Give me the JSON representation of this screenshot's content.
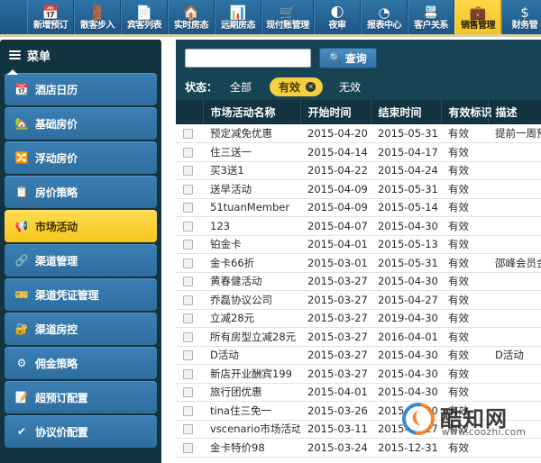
{
  "toolbar": {
    "items": [
      {
        "label": "新增预订",
        "icon": "calendar-icon",
        "active": false
      },
      {
        "label": "散客步入",
        "icon": "door-icon",
        "active": false
      },
      {
        "label": "宾客列表",
        "icon": "document-icon",
        "active": false
      },
      {
        "label": "实时房态",
        "icon": "home-icon",
        "active": false
      },
      {
        "label": "远期房态",
        "icon": "bar-chart-icon",
        "active": false
      },
      {
        "label": "现付账管理",
        "icon": "cart-icon",
        "active": false
      },
      {
        "label": "夜审",
        "icon": "moon-report-icon",
        "active": false
      },
      {
        "label": "报表中心",
        "icon": "pie-chart-icon",
        "active": false
      },
      {
        "label": "客户关系",
        "icon": "contact-card-icon",
        "active": false
      },
      {
        "label": "销售管理",
        "icon": "briefcase-icon",
        "active": true
      },
      {
        "label": "财务管",
        "icon": "dollar-icon",
        "active": false
      }
    ]
  },
  "sidebar": {
    "header": "菜单",
    "header_icon": "hamburger-icon",
    "items": [
      {
        "label": "酒店日历",
        "icon": "calendar-gear-icon",
        "active": false
      },
      {
        "label": "基础房价",
        "icon": "house-gear-icon",
        "active": false
      },
      {
        "label": "浮动房价",
        "icon": "arrow-gear-icon",
        "active": false
      },
      {
        "label": "房价策略",
        "icon": "list-gear-icon",
        "active": false
      },
      {
        "label": "市场活动",
        "icon": "megaphone-gear-icon",
        "active": true
      },
      {
        "label": "渠道管理",
        "icon": "channel-gear-icon",
        "active": false
      },
      {
        "label": "渠道凭证管理",
        "icon": "voucher-gear-icon",
        "active": false
      },
      {
        "label": "渠道房控",
        "icon": "control-gear-icon",
        "active": false
      },
      {
        "label": "佣金策略",
        "icon": "commission-gear-icon",
        "active": false
      },
      {
        "label": "超预订配置",
        "icon": "overbooking-gear-icon",
        "active": false
      },
      {
        "label": "协议价配置",
        "icon": "agreement-ok-icon",
        "active": false
      }
    ]
  },
  "filter": {
    "search_value": "",
    "search_placeholder": "",
    "search_button": "查询",
    "search_icon": "search-icon",
    "status_label": "状态：",
    "status_options": [
      {
        "label": "全部",
        "selected": false
      },
      {
        "label": "有效",
        "selected": true
      },
      {
        "label": "无效",
        "selected": false
      }
    ],
    "clear_icon": "close-circle-icon"
  },
  "table": {
    "columns": [
      "市场活动名称",
      "开始时间",
      "结束时间",
      "有效标识",
      "描述"
    ],
    "rows": [
      {
        "name": "预定减免优惠",
        "start": "2015-04-20",
        "end": "2015-05-31",
        "flag": "有效",
        "desc": "提前一周预订"
      },
      {
        "name": "住三送一",
        "start": "2015-04-14",
        "end": "2015-04-17",
        "flag": "有效",
        "desc": ""
      },
      {
        "name": "买3送1",
        "start": "2015-04-22",
        "end": "2015-04-24",
        "flag": "有效",
        "desc": ""
      },
      {
        "name": "送早活动",
        "start": "2015-04-09",
        "end": "2015-05-31",
        "flag": "有效",
        "desc": ""
      },
      {
        "name": "51tuanMember",
        "start": "2015-04-09",
        "end": "2015-05-14",
        "flag": "有效",
        "desc": ""
      },
      {
        "name": "123",
        "start": "2015-04-07",
        "end": "2015-04-30",
        "flag": "有效",
        "desc": ""
      },
      {
        "name": "铂金卡",
        "start": "2015-04-01",
        "end": "2015-05-13",
        "flag": "有效",
        "desc": ""
      },
      {
        "name": "金卡66折",
        "start": "2015-03-01",
        "end": "2015-05-31",
        "flag": "有效",
        "desc": "邵峰会员金卡"
      },
      {
        "name": "黄春健活动",
        "start": "2015-03-27",
        "end": "2015-04-30",
        "flag": "有效",
        "desc": ""
      },
      {
        "name": "乔磊协议公司",
        "start": "2015-03-27",
        "end": "2015-04-27",
        "flag": "有效",
        "desc": ""
      },
      {
        "name": "立减28元",
        "start": "2015-03-27",
        "end": "2019-04-30",
        "flag": "有效",
        "desc": ""
      },
      {
        "name": "所有房型立减28元",
        "start": "2015-03-27",
        "end": "2016-04-01",
        "flag": "有效",
        "desc": ""
      },
      {
        "name": "D活动",
        "start": "2015-03-27",
        "end": "2015-04-30",
        "flag": "有效",
        "desc": "D活动"
      },
      {
        "name": "新店开业酬宾199",
        "start": "2015-03-27",
        "end": "2015-04-30",
        "flag": "有效",
        "desc": ""
      },
      {
        "name": "旅行团优惠",
        "start": "2015-04-01",
        "end": "2015-04-30",
        "flag": "有效",
        "desc": ""
      },
      {
        "name": "tina住三免一",
        "start": "2015-03-26",
        "end": "2015-04-30",
        "flag": "有效",
        "desc": ""
      },
      {
        "name": "vscenario市场活动",
        "start": "2015-03-11",
        "end": "2015-04-27",
        "flag": "有效",
        "desc": ""
      },
      {
        "name": "金卡特价98",
        "start": "2015-03-24",
        "end": "2015-12-31",
        "flag": "有效",
        "desc": ""
      }
    ]
  },
  "watermark": {
    "text": "酷知网",
    "url": "www.coozhi.com"
  },
  "colors": {
    "toolbar_blue": "#1f5e8a",
    "accent_yellow": "#f5c518",
    "panel_dark": "#123340",
    "filter_bar": "#174454",
    "menu_item_blue": "#3b7fb5"
  }
}
